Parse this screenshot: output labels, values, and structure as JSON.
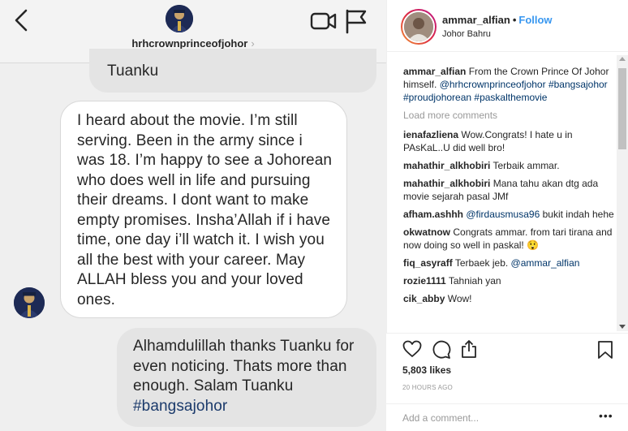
{
  "dm": {
    "username": "hrhcrownprinceofjohor",
    "chevron": "›",
    "messages": [
      {
        "text": "Tuanku"
      },
      {
        "text": "I heard about the movie. I’m still serving. Been in the army since i was 18. I’m happy to see a Johorean who does well in life and pursuing their dreams. I dont want to make empty promises. Insha’Allah if i have time, one day i’ll watch it. I wish you all the best with your career. May ALLAH bless you and your loved ones."
      },
      {
        "text": "Alhamdulillah thanks Tuanku for even noticing. Thats more than enough. Salam Tuanku",
        "tag": "#bangsajohor"
      }
    ],
    "icons": [
      "back-arrow-icon",
      "video-camera-icon",
      "flag-icon"
    ]
  },
  "post": {
    "username": "ammar_alfian",
    "dot": "•",
    "follow_label": "Follow",
    "location": "Johor Bahru",
    "caption": {
      "user": "ammar_alfian",
      "text": "From the Crown Prince Of Johor himself.",
      "mention": "@hrhcrownprinceofjohor",
      "hashtags": "#bangsajohor #proudjohorean #paskalthemovie"
    },
    "load_more": "Load more comments",
    "comments": [
      {
        "user": "ienafazliena",
        "text": "Wow.Congrats! I hate u in PAsKaL..U did well bro!"
      },
      {
        "user": "mahathir_alkhobiri",
        "text": "Terbaik ammar."
      },
      {
        "user": "mahathir_alkhobiri",
        "text": "Mana tahu akan dtg ada movie sejarah pasal JMf"
      },
      {
        "user": "afham.ashhh",
        "mention": "@firdausmusa96",
        "text": "bukit indah hehe"
      },
      {
        "user": "okwatnow",
        "text": "Congrats ammar. from tari tirana and now doing so well in paskal! 😲"
      },
      {
        "user": "fiq_asyraff",
        "text": "Terbaek jeb.",
        "mention": "@ammar_alfian"
      },
      {
        "user": "rozie1111",
        "text": "Tahniah yan"
      },
      {
        "user": "cik_abby",
        "text": "Wow!"
      }
    ],
    "likes": "5,803 likes",
    "timestamp": "20 HOURS AGO",
    "add_comment_placeholder": "Add a comment...",
    "more_label": "•••"
  },
  "colors": {
    "follow": "#3897f0",
    "link": "#003569",
    "dm_background": "#efefef",
    "bubble_grey": "#e4e4e4",
    "hashtag_in_bubble": "#1b3a6b"
  }
}
